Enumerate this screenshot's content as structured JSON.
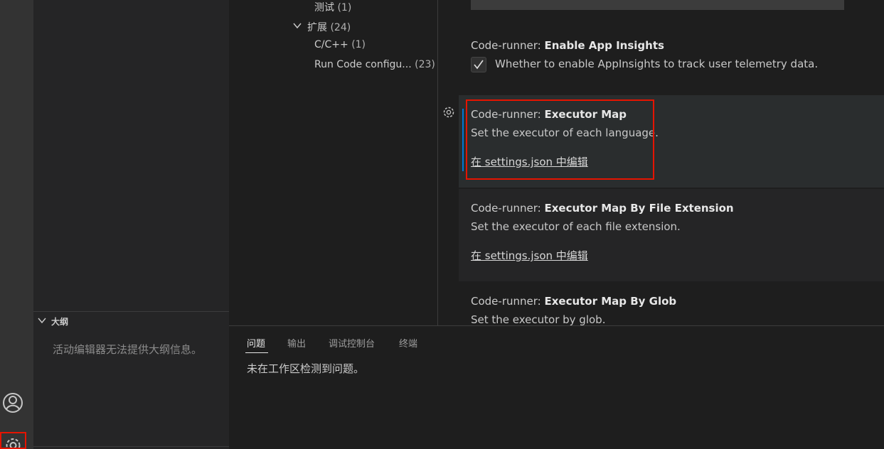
{
  "sidebar": {
    "outline": {
      "title": "大纲",
      "message": "活动编辑器无法提供大纲信息。",
      "chevron_icon": "chevron-down-icon"
    }
  },
  "activity_bar": {
    "accounts_icon": "account-icon",
    "manage_icon": "gear-icon"
  },
  "settings": {
    "toc": [
      {
        "label": "测试",
        "count": "(1)"
      },
      {
        "label": "扩展",
        "count": "(24)"
      },
      {
        "label": "C/C++",
        "count": "(1)"
      },
      {
        "label": "Run Code configu...",
        "count": "(23)"
      }
    ],
    "items": [
      {
        "prefix": "Code-runner: ",
        "name": "Enable App Insights",
        "description": "Whether to enable AppInsights to track user telemetry data.",
        "checked": true
      },
      {
        "prefix": "Code-runner: ",
        "name": "Executor Map",
        "description": "Set the executor of each language.",
        "link": "在 settings.json 中编辑"
      },
      {
        "prefix": "Code-runner: ",
        "name": "Executor Map By File Extension",
        "description": "Set the executor of each file extension.",
        "link": "在 settings.json 中编辑"
      },
      {
        "prefix": "Code-runner: ",
        "name": "Executor Map By Glob",
        "description": "Set the executor by glob."
      }
    ]
  },
  "panel": {
    "tabs": [
      "问题",
      "输出",
      "调试控制台",
      "终端"
    ],
    "active_tab": "问题",
    "message": "未在工作区检测到问题。"
  },
  "colors": {
    "highlight": "#e51400",
    "accent": "#0078d4"
  }
}
